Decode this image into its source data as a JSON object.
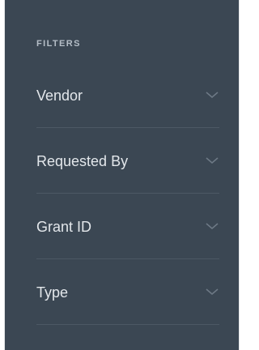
{
  "filters": {
    "heading": "FILTERS",
    "items": [
      {
        "label": "Vendor",
        "icon": "chevron-down-icon"
      },
      {
        "label": "Requested By",
        "icon": "chevron-down-icon"
      },
      {
        "label": "Grant ID",
        "icon": "chevron-down-icon"
      },
      {
        "label": "Type",
        "icon": "chevron-down-icon"
      }
    ]
  },
  "colors": {
    "panel_background": "#3b4753",
    "heading_text": "#b5bec7",
    "item_text": "#e3e7eb",
    "divider": "#4c5864",
    "chevron": "#6e7a86"
  }
}
